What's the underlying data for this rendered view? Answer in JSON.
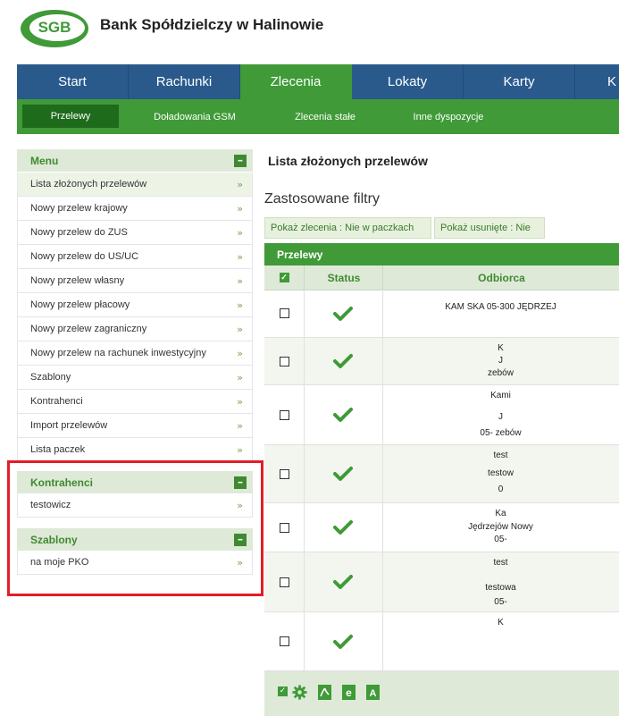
{
  "header": {
    "logo_text": "SGB",
    "bank_name": "Bank Spółdzielczy w Halinowie"
  },
  "topnav": {
    "tabs": [
      {
        "label": "Start"
      },
      {
        "label": "Rachunki"
      },
      {
        "label": "Zlecenia"
      },
      {
        "label": "Lokaty"
      },
      {
        "label": "Karty"
      },
      {
        "label": "K"
      }
    ]
  },
  "subnav": {
    "items": [
      {
        "label": "Przelewy"
      },
      {
        "label": "Doładowania GSM"
      },
      {
        "label": "Zlecenia stałe"
      },
      {
        "label": "Inne dyspozycje"
      }
    ]
  },
  "sidebar": {
    "menu_title": "Menu",
    "items": [
      {
        "label": "Lista złożonych przelewów"
      },
      {
        "label": "Nowy przelew krajowy"
      },
      {
        "label": "Nowy przelew do ZUS"
      },
      {
        "label": "Nowy przelew do US/UC"
      },
      {
        "label": "Nowy przelew własny"
      },
      {
        "label": "Nowy przelew płacowy"
      },
      {
        "label": "Nowy przelew zagraniczny"
      },
      {
        "label": "Nowy przelew na rachunek inwestycyjny"
      },
      {
        "label": "Szablony"
      },
      {
        "label": "Kontrahenci"
      },
      {
        "label": "Import przelewów"
      },
      {
        "label": "Lista paczek"
      }
    ],
    "contractors_title": "Kontrahenci",
    "contractors": [
      {
        "label": "testowicz"
      }
    ],
    "templates_title": "Szablony",
    "templates": [
      {
        "label": "na moje PKO"
      }
    ],
    "arrow_glyph": "»",
    "collapse_glyph": "–"
  },
  "main": {
    "title": "Lista złożonych przelewów",
    "filters_title": "Zastosowane filtry",
    "filters": [
      {
        "label": "Pokaż zlecenia : Nie w paczkach"
      },
      {
        "label": "Pokaż usunięte : Nie"
      }
    ],
    "section_title": "Przelewy",
    "columns": {
      "status": "Status",
      "recipient": "Odbiorca"
    },
    "rows": [
      {
        "lines": [
          "KAM        SKA 05-300 JĘDRZEJ",
          "                         "
        ]
      },
      {
        "lines": [
          "K          ",
          "J            ",
          "                  zebów"
        ]
      },
      {
        "lines": [
          "Kami       ",
          "J                       ",
          "05-         zebów"
        ]
      },
      {
        "lines": [
          "test",
          "testow      ",
          "0     "
        ]
      },
      {
        "lines": [
          "Ka          ",
          "Jędrzejów Nowy         ",
          "05-              "
        ]
      },
      {
        "lines": [
          "test",
          "testowa     ",
          "05-     "
        ]
      },
      {
        "lines": [
          "K          ",
          "                       ",
          "                  "
        ]
      }
    ]
  }
}
